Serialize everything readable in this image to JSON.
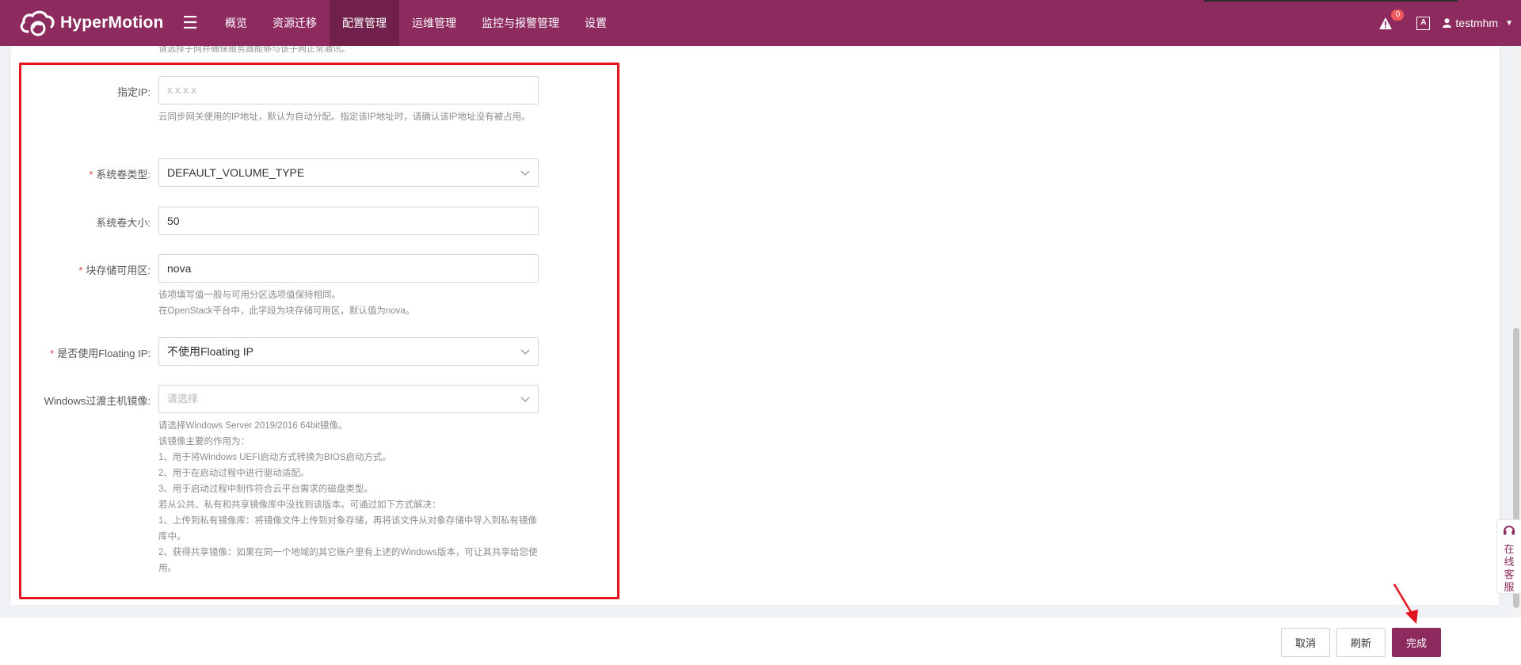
{
  "app": {
    "name": "HyperMotion"
  },
  "nav": {
    "items": [
      {
        "label": "概览",
        "active": false
      },
      {
        "label": "资源迁移",
        "active": false
      },
      {
        "label": "配置管理",
        "active": true
      },
      {
        "label": "运维管理",
        "active": false
      },
      {
        "label": "监控与报警管理",
        "active": false
      },
      {
        "label": "设置",
        "active": false
      }
    ]
  },
  "header": {
    "alert_count": "0",
    "lang_label": "A",
    "username": "testmhm"
  },
  "form": {
    "top_note": "请选择子网并确保服务器能够与该子网正常通讯。",
    "specified_ip": {
      "label": "指定IP:",
      "placeholder": "x.x.x.x",
      "help": "云同步网关使用的IP地址，默认为自动分配。指定该IP地址时，请确认该IP地址没有被占用。"
    },
    "system_volume_type": {
      "required_mark": "*",
      "label": "系统卷类型:",
      "value": "DEFAULT_VOLUME_TYPE"
    },
    "system_volume_size": {
      "label": "系统卷大小:",
      "value": "50"
    },
    "block_storage_zone": {
      "required_mark": "*",
      "label": "块存储可用区:",
      "value": "nova",
      "help": [
        "该项填写值一般与可用分区选项值保持相同。",
        "在OpenStack平台中，此字段为块存储可用区，默认值为nova。"
      ]
    },
    "use_floating_ip": {
      "required_mark": "*",
      "label": "是否使用Floating IP:",
      "value": "不使用Floating IP"
    },
    "windows_image": {
      "label": "Windows过渡主机镜像:",
      "placeholder": "请选择",
      "help": [
        "请选择Windows Server 2019/2016 64bit镜像。",
        "该镜像主要的作用为：",
        "1、用于将Windows UEFI启动方式转换为BIOS启动方式。",
        "2、用于在启动过程中进行驱动适配。",
        "3、用于启动过程中制作符合云平台需求的磁盘类型。",
        "若从公共、私有和共享镜像库中没找到该版本。可通过如下方式解决：",
        "1、上传到私有镜像库：将镜像文件上传到对象存储，再将该文件从对象存储中导入到私有镜像库中。",
        "2、获得共享镜像：如果在同一个地域的其它账户里有上述的Windows版本，可让其共享给您使用。"
      ]
    }
  },
  "service": {
    "label": "在线客服"
  },
  "footer": {
    "cancel_label": "取消",
    "refresh_label": "刷新",
    "finish_label": "完成"
  },
  "colors": {
    "brand": "#8d2a5e",
    "brand_dark": "#70204a",
    "highlight_border": "#e3141d",
    "required": "#e54545"
  }
}
